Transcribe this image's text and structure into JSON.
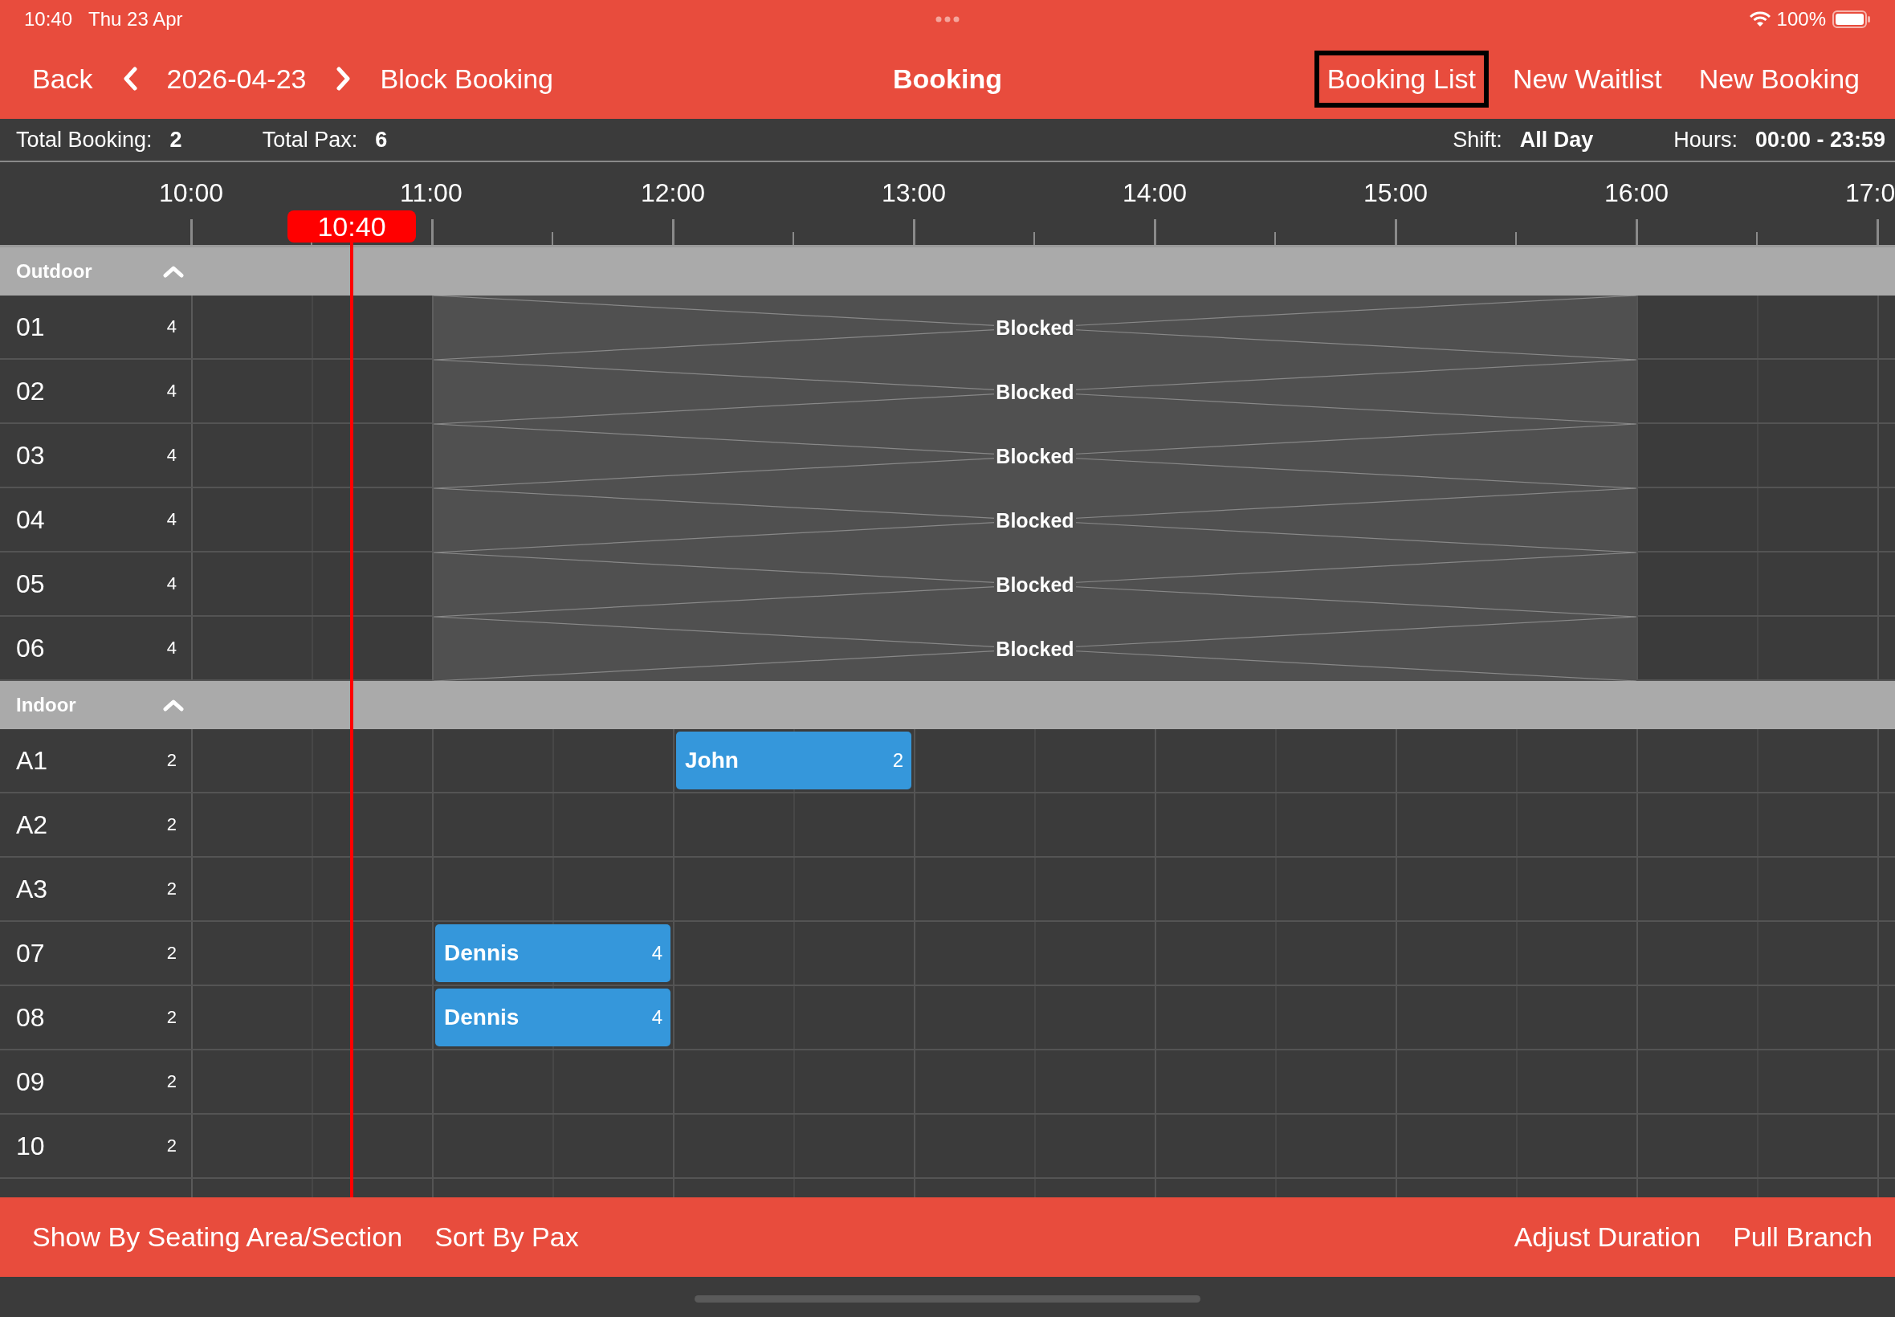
{
  "status_bar": {
    "time": "10:40",
    "date": "Thu 23 Apr",
    "battery": "100%"
  },
  "nav": {
    "back": "Back",
    "date": "2026-04-23",
    "block_booking": "Block Booking",
    "title": "Booking",
    "actions": [
      {
        "label": "Booking List",
        "selected": true
      },
      {
        "label": "New Waitlist",
        "selected": false
      },
      {
        "label": "New Booking",
        "selected": false
      }
    ]
  },
  "summary": {
    "total_booking_label": "Total Booking:",
    "total_booking": "2",
    "total_pax_label": "Total Pax:",
    "total_pax": "6",
    "shift_label": "Shift:",
    "shift": "All Day",
    "hours_label": "Hours:",
    "hours": "00:00 - 23:59"
  },
  "timeline": {
    "hours": [
      "10:00",
      "11:00",
      "12:00",
      "13:00",
      "14:00",
      "15:00",
      "16:00",
      "17:0"
    ],
    "now": "10:40"
  },
  "sections": [
    {
      "name": "Outdoor",
      "expanded": true,
      "tables": [
        {
          "name": "01",
          "capacity": "4",
          "entries": [
            {
              "kind": "blocked",
              "label": "Blocked"
            }
          ]
        },
        {
          "name": "02",
          "capacity": "4",
          "entries": [
            {
              "kind": "blocked",
              "label": "Blocked"
            }
          ]
        },
        {
          "name": "03",
          "capacity": "4",
          "entries": [
            {
              "kind": "blocked",
              "label": "Blocked"
            }
          ]
        },
        {
          "name": "04",
          "capacity": "4",
          "entries": [
            {
              "kind": "blocked",
              "label": "Blocked"
            }
          ]
        },
        {
          "name": "05",
          "capacity": "4",
          "entries": [
            {
              "kind": "blocked",
              "label": "Blocked"
            }
          ]
        },
        {
          "name": "06",
          "capacity": "4",
          "entries": [
            {
              "kind": "blocked",
              "label": "Blocked"
            }
          ]
        }
      ]
    },
    {
      "name": "Indoor",
      "expanded": true,
      "tables": [
        {
          "name": "A1",
          "capacity": "2",
          "entries": [
            {
              "kind": "booking",
              "label": "John",
              "pax": "2"
            }
          ]
        },
        {
          "name": "A2",
          "capacity": "2"
        },
        {
          "name": "A3",
          "capacity": "2"
        },
        {
          "name": "07",
          "capacity": "2",
          "entries": [
            {
              "kind": "booking",
              "label": "Dennis",
              "pax": "4"
            }
          ]
        },
        {
          "name": "08",
          "capacity": "2",
          "entries": [
            {
              "kind": "booking",
              "label": "Dennis",
              "pax": "4"
            }
          ]
        },
        {
          "name": "09",
          "capacity": "2"
        },
        {
          "name": "10",
          "capacity": "2"
        }
      ]
    }
  ],
  "footer": {
    "left": [
      "Show By Seating Area/Section",
      "Sort By Pax"
    ],
    "right": [
      "Adjust Duration",
      "Pull Branch"
    ]
  }
}
